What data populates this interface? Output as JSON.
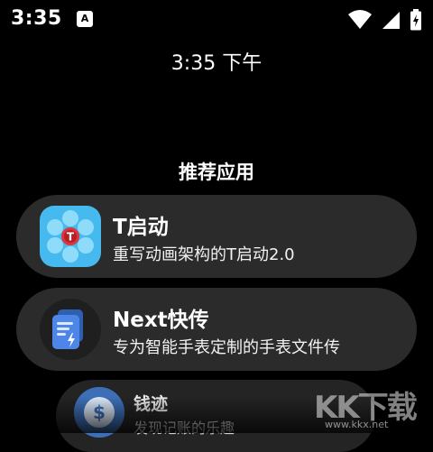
{
  "status_bar": {
    "time": "3:35",
    "notification_icon_letter": "A"
  },
  "clock": "3:35 下午",
  "section_title": "推荐应用",
  "apps": [
    {
      "title": "T启动",
      "description": "重写动画架构的T启动2.0"
    },
    {
      "title": "Next快传",
      "description": "专为智能手表定制的手表文件传"
    },
    {
      "title": "钱迹",
      "description": "发现记账的乐趣"
    }
  ],
  "icon_badge_letter": "T",
  "watermark": {
    "text": "KK下载",
    "url": "www.kkx.net"
  },
  "colors": {
    "background": "#000000",
    "card": "#2b2b2b",
    "t_icon_blue": "#5ec8f2",
    "t_icon_red": "#e0333b",
    "next_icon_blue": "#4d86e8",
    "qianji_blue": "#3d6fb6"
  }
}
